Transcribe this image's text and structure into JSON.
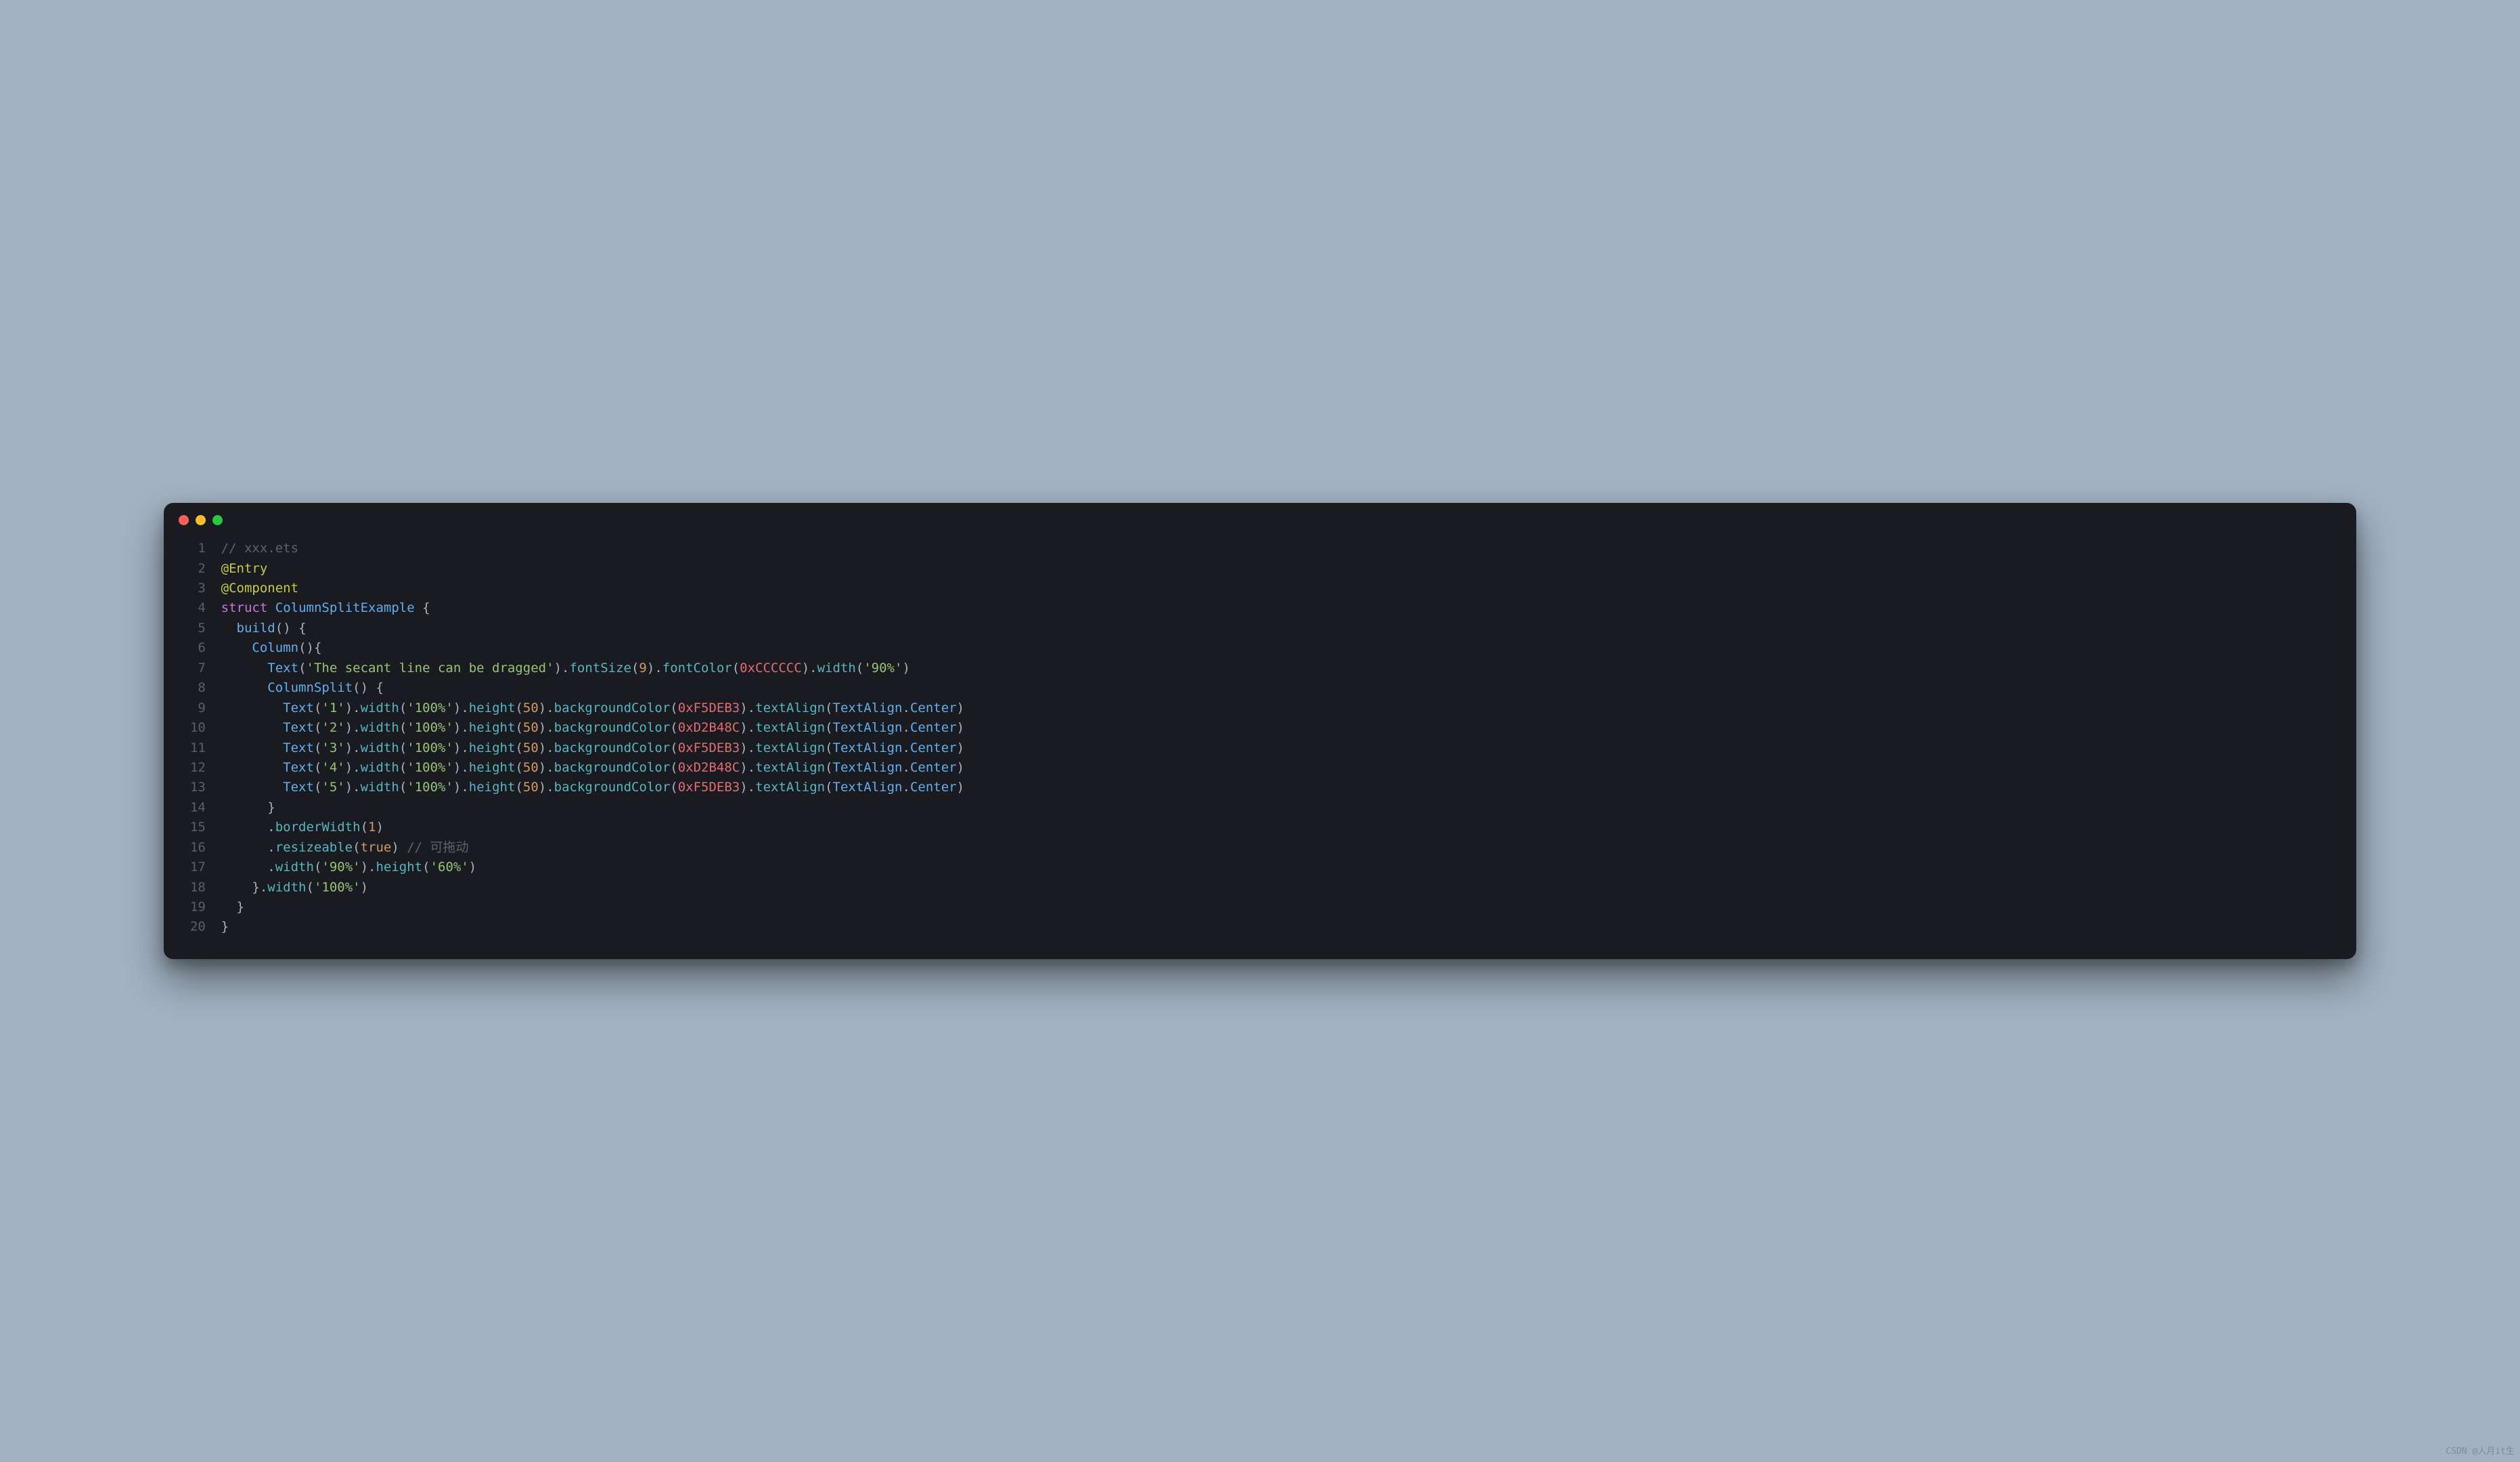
{
  "window": {
    "traffic_lights": [
      "close",
      "minimize",
      "zoom"
    ]
  },
  "watermark": "CSDN @人月it生",
  "code": {
    "lines": [
      {
        "n": "1",
        "tokens": [
          {
            "t": "// xxx.ets",
            "c": "cm"
          }
        ]
      },
      {
        "n": "2",
        "tokens": [
          {
            "t": "@Entry",
            "c": "dec"
          }
        ]
      },
      {
        "n": "3",
        "tokens": [
          {
            "t": "@Component",
            "c": "dec"
          }
        ]
      },
      {
        "n": "4",
        "tokens": [
          {
            "t": "struct",
            "c": "kw"
          },
          {
            "t": " ",
            "c": "pn"
          },
          {
            "t": "ColumnSplitExample",
            "c": "fn"
          },
          {
            "t": " {",
            "c": "pn"
          }
        ]
      },
      {
        "n": "5",
        "tokens": [
          {
            "t": "  ",
            "c": "pn"
          },
          {
            "t": "build",
            "c": "fn"
          },
          {
            "t": "() {",
            "c": "pn"
          }
        ]
      },
      {
        "n": "6",
        "tokens": [
          {
            "t": "    ",
            "c": "pn"
          },
          {
            "t": "Column",
            "c": "fn"
          },
          {
            "t": "(){",
            "c": "pn"
          }
        ]
      },
      {
        "n": "7",
        "tokens": [
          {
            "t": "      ",
            "c": "pn"
          },
          {
            "t": "Text",
            "c": "fn"
          },
          {
            "t": "(",
            "c": "pn"
          },
          {
            "t": "'The secant line can be dragged'",
            "c": "str"
          },
          {
            "t": ").",
            "c": "pn"
          },
          {
            "t": "fontSize",
            "c": "mth"
          },
          {
            "t": "(",
            "c": "pn"
          },
          {
            "t": "9",
            "c": "num"
          },
          {
            "t": ").",
            "c": "pn"
          },
          {
            "t": "fontColor",
            "c": "mth"
          },
          {
            "t": "(",
            "c": "pn"
          },
          {
            "t": "0xCCCCCC",
            "c": "hex"
          },
          {
            "t": ").",
            "c": "pn"
          },
          {
            "t": "width",
            "c": "mth"
          },
          {
            "t": "(",
            "c": "pn"
          },
          {
            "t": "'90%'",
            "c": "str"
          },
          {
            "t": ")",
            "c": "pn"
          }
        ]
      },
      {
        "n": "8",
        "tokens": [
          {
            "t": "      ",
            "c": "pn"
          },
          {
            "t": "ColumnSplit",
            "c": "fn"
          },
          {
            "t": "() {",
            "c": "pn"
          }
        ]
      },
      {
        "n": "9",
        "tokens": [
          {
            "t": "        ",
            "c": "pn"
          },
          {
            "t": "Text",
            "c": "fn"
          },
          {
            "t": "(",
            "c": "pn"
          },
          {
            "t": "'1'",
            "c": "str"
          },
          {
            "t": ").",
            "c": "pn"
          },
          {
            "t": "width",
            "c": "mth"
          },
          {
            "t": "(",
            "c": "pn"
          },
          {
            "t": "'100%'",
            "c": "str"
          },
          {
            "t": ").",
            "c": "pn"
          },
          {
            "t": "height",
            "c": "mth"
          },
          {
            "t": "(",
            "c": "pn"
          },
          {
            "t": "50",
            "c": "num"
          },
          {
            "t": ").",
            "c": "pn"
          },
          {
            "t": "backgroundColor",
            "c": "mth"
          },
          {
            "t": "(",
            "c": "pn"
          },
          {
            "t": "0xF5DEB3",
            "c": "hex"
          },
          {
            "t": ").",
            "c": "pn"
          },
          {
            "t": "textAlign",
            "c": "mth"
          },
          {
            "t": "(",
            "c": "pn"
          },
          {
            "t": "TextAlign",
            "c": "fn"
          },
          {
            "t": ".",
            "c": "pn"
          },
          {
            "t": "Center",
            "c": "fn"
          },
          {
            "t": ")",
            "c": "pn"
          }
        ]
      },
      {
        "n": "10",
        "tokens": [
          {
            "t": "        ",
            "c": "pn"
          },
          {
            "t": "Text",
            "c": "fn"
          },
          {
            "t": "(",
            "c": "pn"
          },
          {
            "t": "'2'",
            "c": "str"
          },
          {
            "t": ").",
            "c": "pn"
          },
          {
            "t": "width",
            "c": "mth"
          },
          {
            "t": "(",
            "c": "pn"
          },
          {
            "t": "'100%'",
            "c": "str"
          },
          {
            "t": ").",
            "c": "pn"
          },
          {
            "t": "height",
            "c": "mth"
          },
          {
            "t": "(",
            "c": "pn"
          },
          {
            "t": "50",
            "c": "num"
          },
          {
            "t": ").",
            "c": "pn"
          },
          {
            "t": "backgroundColor",
            "c": "mth"
          },
          {
            "t": "(",
            "c": "pn"
          },
          {
            "t": "0xD2B48C",
            "c": "hex"
          },
          {
            "t": ").",
            "c": "pn"
          },
          {
            "t": "textAlign",
            "c": "mth"
          },
          {
            "t": "(",
            "c": "pn"
          },
          {
            "t": "TextAlign",
            "c": "fn"
          },
          {
            "t": ".",
            "c": "pn"
          },
          {
            "t": "Center",
            "c": "fn"
          },
          {
            "t": ")",
            "c": "pn"
          }
        ]
      },
      {
        "n": "11",
        "tokens": [
          {
            "t": "        ",
            "c": "pn"
          },
          {
            "t": "Text",
            "c": "fn"
          },
          {
            "t": "(",
            "c": "pn"
          },
          {
            "t": "'3'",
            "c": "str"
          },
          {
            "t": ").",
            "c": "pn"
          },
          {
            "t": "width",
            "c": "mth"
          },
          {
            "t": "(",
            "c": "pn"
          },
          {
            "t": "'100%'",
            "c": "str"
          },
          {
            "t": ").",
            "c": "pn"
          },
          {
            "t": "height",
            "c": "mth"
          },
          {
            "t": "(",
            "c": "pn"
          },
          {
            "t": "50",
            "c": "num"
          },
          {
            "t": ").",
            "c": "pn"
          },
          {
            "t": "backgroundColor",
            "c": "mth"
          },
          {
            "t": "(",
            "c": "pn"
          },
          {
            "t": "0xF5DEB3",
            "c": "hex"
          },
          {
            "t": ").",
            "c": "pn"
          },
          {
            "t": "textAlign",
            "c": "mth"
          },
          {
            "t": "(",
            "c": "pn"
          },
          {
            "t": "TextAlign",
            "c": "fn"
          },
          {
            "t": ".",
            "c": "pn"
          },
          {
            "t": "Center",
            "c": "fn"
          },
          {
            "t": ")",
            "c": "pn"
          }
        ]
      },
      {
        "n": "12",
        "tokens": [
          {
            "t": "        ",
            "c": "pn"
          },
          {
            "t": "Text",
            "c": "fn"
          },
          {
            "t": "(",
            "c": "pn"
          },
          {
            "t": "'4'",
            "c": "str"
          },
          {
            "t": ").",
            "c": "pn"
          },
          {
            "t": "width",
            "c": "mth"
          },
          {
            "t": "(",
            "c": "pn"
          },
          {
            "t": "'100%'",
            "c": "str"
          },
          {
            "t": ").",
            "c": "pn"
          },
          {
            "t": "height",
            "c": "mth"
          },
          {
            "t": "(",
            "c": "pn"
          },
          {
            "t": "50",
            "c": "num"
          },
          {
            "t": ").",
            "c": "pn"
          },
          {
            "t": "backgroundColor",
            "c": "mth"
          },
          {
            "t": "(",
            "c": "pn"
          },
          {
            "t": "0xD2B48C",
            "c": "hex"
          },
          {
            "t": ").",
            "c": "pn"
          },
          {
            "t": "textAlign",
            "c": "mth"
          },
          {
            "t": "(",
            "c": "pn"
          },
          {
            "t": "TextAlign",
            "c": "fn"
          },
          {
            "t": ".",
            "c": "pn"
          },
          {
            "t": "Center",
            "c": "fn"
          },
          {
            "t": ")",
            "c": "pn"
          }
        ]
      },
      {
        "n": "13",
        "tokens": [
          {
            "t": "        ",
            "c": "pn"
          },
          {
            "t": "Text",
            "c": "fn"
          },
          {
            "t": "(",
            "c": "pn"
          },
          {
            "t": "'5'",
            "c": "str"
          },
          {
            "t": ").",
            "c": "pn"
          },
          {
            "t": "width",
            "c": "mth"
          },
          {
            "t": "(",
            "c": "pn"
          },
          {
            "t": "'100%'",
            "c": "str"
          },
          {
            "t": ").",
            "c": "pn"
          },
          {
            "t": "height",
            "c": "mth"
          },
          {
            "t": "(",
            "c": "pn"
          },
          {
            "t": "50",
            "c": "num"
          },
          {
            "t": ").",
            "c": "pn"
          },
          {
            "t": "backgroundColor",
            "c": "mth"
          },
          {
            "t": "(",
            "c": "pn"
          },
          {
            "t": "0xF5DEB3",
            "c": "hex"
          },
          {
            "t": ").",
            "c": "pn"
          },
          {
            "t": "textAlign",
            "c": "mth"
          },
          {
            "t": "(",
            "c": "pn"
          },
          {
            "t": "TextAlign",
            "c": "fn"
          },
          {
            "t": ".",
            "c": "pn"
          },
          {
            "t": "Center",
            "c": "fn"
          },
          {
            "t": ")",
            "c": "pn"
          }
        ]
      },
      {
        "n": "14",
        "tokens": [
          {
            "t": "      }",
            "c": "pn"
          }
        ]
      },
      {
        "n": "15",
        "tokens": [
          {
            "t": "      .",
            "c": "pn"
          },
          {
            "t": "borderWidth",
            "c": "mth"
          },
          {
            "t": "(",
            "c": "pn"
          },
          {
            "t": "1",
            "c": "num"
          },
          {
            "t": ")",
            "c": "pn"
          }
        ]
      },
      {
        "n": "16",
        "tokens": [
          {
            "t": "      .",
            "c": "pn"
          },
          {
            "t": "resizeable",
            "c": "mth"
          },
          {
            "t": "(",
            "c": "pn"
          },
          {
            "t": "true",
            "c": "bool"
          },
          {
            "t": ") ",
            "c": "pn"
          },
          {
            "t": "// 可拖动",
            "c": "cm"
          }
        ]
      },
      {
        "n": "17",
        "tokens": [
          {
            "t": "      .",
            "c": "pn"
          },
          {
            "t": "width",
            "c": "mth"
          },
          {
            "t": "(",
            "c": "pn"
          },
          {
            "t": "'90%'",
            "c": "str"
          },
          {
            "t": ").",
            "c": "pn"
          },
          {
            "t": "height",
            "c": "mth"
          },
          {
            "t": "(",
            "c": "pn"
          },
          {
            "t": "'60%'",
            "c": "str"
          },
          {
            "t": ")",
            "c": "pn"
          }
        ]
      },
      {
        "n": "18",
        "tokens": [
          {
            "t": "    }.",
            "c": "pn"
          },
          {
            "t": "width",
            "c": "mth"
          },
          {
            "t": "(",
            "c": "pn"
          },
          {
            "t": "'100%'",
            "c": "str"
          },
          {
            "t": ")",
            "c": "pn"
          }
        ]
      },
      {
        "n": "19",
        "tokens": [
          {
            "t": "  }",
            "c": "pn"
          }
        ]
      },
      {
        "n": "20",
        "tokens": [
          {
            "t": "}",
            "c": "pn"
          }
        ]
      }
    ]
  }
}
